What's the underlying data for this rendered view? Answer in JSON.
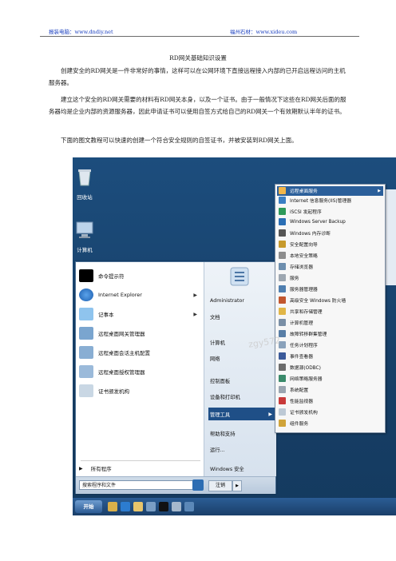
{
  "header": {
    "left_text": "报装电脑：www.dndiy.net",
    "right_text": "福州石材：www.xideu.com"
  },
  "document": {
    "title": "RD网关基础知识设置",
    "paragraphs": [
      "创建安全的RD网关是一件非常好的事情，这样可以在公网环境下直接远程接入内部的已开启远程访问的主机服务器。",
      "建立这个安全的RD网关需要的材料有RD网关本身，以及一个证书。由于一般情况下这些在RD网关后面的服务器均是企业内部的资源服务器，因此申请证书可以使用自签方式给自己的RD网关一个有效期默认半年的证书。",
      "下面的图文教程可以快速的创建一个符合安全规则的自签证书，并被安装到RD网关上面。"
    ]
  },
  "screenshot": {
    "desktop_icons": [
      {
        "label": "回收站",
        "icon": "recycle-bin-icon"
      },
      {
        "label": "计算机",
        "icon": "computer-icon"
      }
    ],
    "start_menu": {
      "left_items": [
        {
          "label": "命令提示符",
          "icon": "cmd-icon",
          "arrow": ""
        },
        {
          "label": "Internet Explorer",
          "icon": "ie-icon",
          "arrow": "▶"
        },
        {
          "label": "记事本",
          "icon": "notepad-icon",
          "arrow": "▶"
        },
        {
          "label": "远程桌面网关管理器",
          "icon": "rd-gateway-icon",
          "arrow": ""
        },
        {
          "label": "远程桌面会话主机配置",
          "icon": "rd-session-icon",
          "arrow": ""
        },
        {
          "label": "远程桌面授权管理器",
          "icon": "rd-license-icon",
          "arrow": ""
        },
        {
          "label": "证书颁发机构",
          "icon": "cert-authority-icon",
          "arrow": ""
        }
      ],
      "all_programs": "所有程序",
      "search_placeholder": "搜索程序和文件",
      "right_items": [
        {
          "label": "Administrator",
          "arrow": ""
        },
        {
          "label": "文档",
          "arrow": ""
        },
        {
          "label": "计算机",
          "arrow": ""
        },
        {
          "label": "网络",
          "arrow": ""
        },
        {
          "label": "控制面板",
          "arrow": ""
        },
        {
          "label": "设备和打印机",
          "arrow": ""
        },
        {
          "label": "管理工具",
          "arrow": "▶"
        },
        {
          "label": "帮助和支持",
          "arrow": ""
        },
        {
          "label": "运行...",
          "arrow": ""
        },
        {
          "label": "Windows 安全",
          "arrow": ""
        }
      ],
      "logoff": "注销",
      "logoff_arrow": "▶"
    },
    "admin_tools_menu": [
      {
        "label": "远程桌面服务",
        "arrow": "▶",
        "selected": true
      },
      {
        "label": "Internet 信息服务(IIS)管理器",
        "arrow": "",
        "selected": false
      },
      {
        "label": "iSCSI 发起程序",
        "arrow": "",
        "selected": false
      },
      {
        "label": "Windows Server Backup",
        "arrow": "",
        "selected": false
      },
      {
        "label": "Windows 内存诊断",
        "arrow": "",
        "selected": false
      },
      {
        "label": "安全配置向导",
        "arrow": "",
        "selected": false
      },
      {
        "label": "本地安全策略",
        "arrow": "",
        "selected": false
      },
      {
        "label": "存储浏览器",
        "arrow": "",
        "selected": false
      },
      {
        "label": "服务",
        "arrow": "",
        "selected": false
      },
      {
        "label": "服务器管理器",
        "arrow": "",
        "selected": false
      },
      {
        "label": "高级安全 Windows 防火墙",
        "arrow": "",
        "selected": false
      },
      {
        "label": "共享和存储管理",
        "arrow": "",
        "selected": false
      },
      {
        "label": "计算机管理",
        "arrow": "",
        "selected": false
      },
      {
        "label": "故障转移群集管理",
        "arrow": "",
        "selected": false
      },
      {
        "label": "任务计划程序",
        "arrow": "",
        "selected": false
      },
      {
        "label": "事件查看器",
        "arrow": "",
        "selected": false
      },
      {
        "label": "数据源(ODBC)",
        "arrow": "",
        "selected": false
      },
      {
        "label": "网络策略服务器",
        "arrow": "",
        "selected": false
      },
      {
        "label": "系统配置",
        "arrow": "",
        "selected": false
      },
      {
        "label": "性能监视器",
        "arrow": "",
        "selected": false
      },
      {
        "label": "证书颁发机构",
        "arrow": "",
        "selected": false
      },
      {
        "label": "组件服务",
        "arrow": "",
        "selected": false
      }
    ],
    "taskbar": {
      "start_label": "开始"
    },
    "watermark": "zgy572"
  },
  "colors": {
    "link": "#1a3fbf",
    "desktop": "#1c4d7d",
    "selection": "#1f4f87"
  }
}
